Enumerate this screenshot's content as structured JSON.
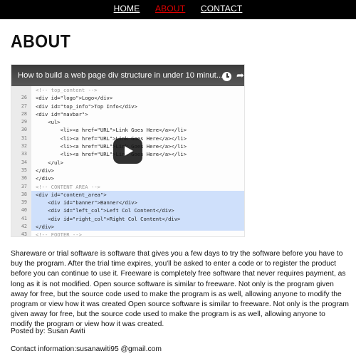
{
  "nav": {
    "items": [
      {
        "label": "HOME",
        "active": false
      },
      {
        "label": "ABOUT",
        "active": true
      },
      {
        "label": "CONTACT",
        "active": false
      }
    ],
    "active_color": "#e00000"
  },
  "page_title": "ABOUT",
  "video": {
    "title": "How to build a web page div structure in under 10 minut...",
    "icons": [
      "clock-icon",
      "share-icon",
      "play-icon"
    ],
    "code_lines": [
      {
        "num": "",
        "text": "<!-- top_content -->",
        "comment": true,
        "hl": false,
        "mark": ""
      },
      {
        "num": "26",
        "text": "<div id=\"logo\">Logo</div>",
        "comment": false,
        "hl": false,
        "mark": ""
      },
      {
        "num": "27",
        "text": "<div id=\"top_info\">Top Info</div>",
        "comment": false,
        "hl": false,
        "mark": ""
      },
      {
        "num": "28",
        "text": "<div id=\"navbar\">",
        "comment": false,
        "hl": false,
        "mark": ""
      },
      {
        "num": "29",
        "text": "    <ul>",
        "comment": false,
        "hl": false,
        "mark": ""
      },
      {
        "num": "30",
        "text": "        <li><a href=\"URL\">Link Goes Here</a></li>",
        "comment": false,
        "hl": false,
        "mark": ""
      },
      {
        "num": "31",
        "text": "        <li><a href=\"URL\">Link Goes Here</a></li>",
        "comment": false,
        "hl": false,
        "mark": ""
      },
      {
        "num": "32",
        "text": "        <li><a href=\"URL\">Link Goes Here</a></li>",
        "comment": false,
        "hl": false,
        "mark": ""
      },
      {
        "num": "33",
        "text": "        <li><a href=\"URL\">Link Goes Here</a></li>",
        "comment": false,
        "hl": false,
        "mark": ""
      },
      {
        "num": "34",
        "text": "    </ul>",
        "comment": false,
        "hl": false,
        "mark": ""
      },
      {
        "num": "35",
        "text": "</div>",
        "comment": false,
        "hl": false,
        "mark": ""
      },
      {
        "num": "36",
        "text": "</div>",
        "comment": false,
        "hl": false,
        "mark": ""
      },
      {
        "num": "37",
        "text": "<!-- CONTENT AREA -->",
        "comment": true,
        "hl": false,
        "mark": ""
      },
      {
        "num": "38",
        "text": "<div id=\"content_area\">",
        "comment": false,
        "hl": true,
        "mark": "▼"
      },
      {
        "num": "39",
        "text": "    <div id=\"banner\">Banner</div>",
        "comment": false,
        "hl": true,
        "mark": ""
      },
      {
        "num": "40",
        "text": "    <div id=\"left_col\">Left Col Content</div>",
        "comment": false,
        "hl": true,
        "mark": ""
      },
      {
        "num": "41",
        "text": "    <div id=\"right_col\">Right Col Content</div>",
        "comment": false,
        "hl": true,
        "mark": ""
      },
      {
        "num": "42",
        "text": "</div>",
        "comment": false,
        "hl": true,
        "mark": "▲"
      },
      {
        "num": "43",
        "text": "<!-- FOOTER -->",
        "comment": true,
        "hl": false,
        "mark": ""
      },
      {
        "num": "44",
        "text": "<div id...",
        "comment": false,
        "hl": false,
        "mark": ""
      },
      {
        "num": "45",
        "text": "</div><!-- END CONTAINER -->",
        "comment": false,
        "hl": false,
        "mark": ""
      }
    ]
  },
  "body_text": "Shareware or trial software is software that gives you a few days to try the software before you have to buy the program. After the trial time expires, you'll be asked to enter a code or to register the product before you can continue to use it. Freeware is completely free software that never requires payment, as long as it is not modified. Open source software is similar to freeware. Not only is the program given away for free, but the source code used to make the program is as well, allowing anyone to modify the program or view how it was created Open source software is similar to freeware. Not only is the program given away for free, but the source code used to make the program is as well, allowing anyone to modify the program or view how it was created.",
  "posted_by": "Posted by: Susan Awiti",
  "contact": "Contact information:susanawiti95 @gmail.com"
}
